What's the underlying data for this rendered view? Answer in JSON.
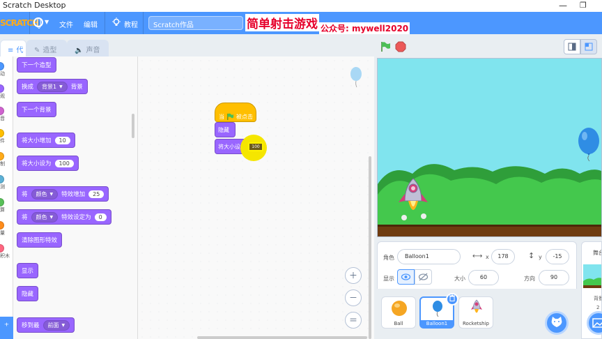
{
  "window": {
    "title": "Scratch Desktop"
  },
  "menu": {
    "logo": "SCRATCH",
    "file": "文件",
    "edit": "编辑",
    "tutorials": "教程",
    "project_title": "Scratch作品"
  },
  "overlay": {
    "title": "简单射击游戏",
    "subtitle": "公众号: mywell2020"
  },
  "tabs": {
    "code": "代码",
    "costumes": "造型",
    "sounds": "声音"
  },
  "categories": [
    {
      "label": "动",
      "color": "#4c97ff"
    },
    {
      "label": "观",
      "color": "#9966ff"
    },
    {
      "label": "音",
      "color": "#cf63cf"
    },
    {
      "label": "件",
      "color": "#ffbf00"
    },
    {
      "label": "制",
      "color": "#ffab19"
    },
    {
      "label": "测",
      "color": "#5cb1d6"
    },
    {
      "label": "算",
      "color": "#59c059"
    },
    {
      "label": "量",
      "color": "#ff8c1a"
    },
    {
      "label": "积木",
      "color": "#ff6680"
    }
  ],
  "palette": {
    "next_costume": "下一个造型",
    "switch_backdrop": "换成",
    "backdrop_value": "背景1",
    "backdrop_suffix": "背景",
    "next_backdrop": "下一个背景",
    "change_size": "将大小增加",
    "change_size_value": "10",
    "set_size": "将大小设为",
    "set_size_value": "100",
    "change_effect_prefix": "将",
    "effect_value": "颜色",
    "change_effect_suffix": "特效增加",
    "change_effect_value": "25",
    "set_effect_prefix": "将",
    "set_effect_value": "颜色",
    "set_effect_suffix": "特效设定为",
    "set_effect_number": "0",
    "clear_effects": "清除图形特效",
    "show": "显示",
    "hide": "隐藏",
    "go_to": "移到最",
    "go_to_value": "前面"
  },
  "script": {
    "hat_prefix": "当",
    "hat_suffix": "被点击",
    "hide": "隐藏",
    "set_size": "将大小设为",
    "set_size_value": "100"
  },
  "sprite_info": {
    "sprite_label": "角色",
    "sprite_name": "Balloon1",
    "x_label": "x",
    "x_value": "178",
    "y_label": "y",
    "y_value": "-15",
    "show_label": "显示",
    "size_label": "大小",
    "size_value": "60",
    "direction_label": "方向",
    "direction_value": "90"
  },
  "sprites": [
    {
      "name": "Ball"
    },
    {
      "name": "Balloon1"
    },
    {
      "name": "Rocketship"
    }
  ],
  "stage_panel": {
    "label": "舞台",
    "backdrops_label": "背景",
    "backdrops_count": "2"
  },
  "colors": {
    "accent": "#4c97ff",
    "looks": "#9966ff",
    "events": "#ffbf00",
    "highlight": "#f5e600"
  }
}
